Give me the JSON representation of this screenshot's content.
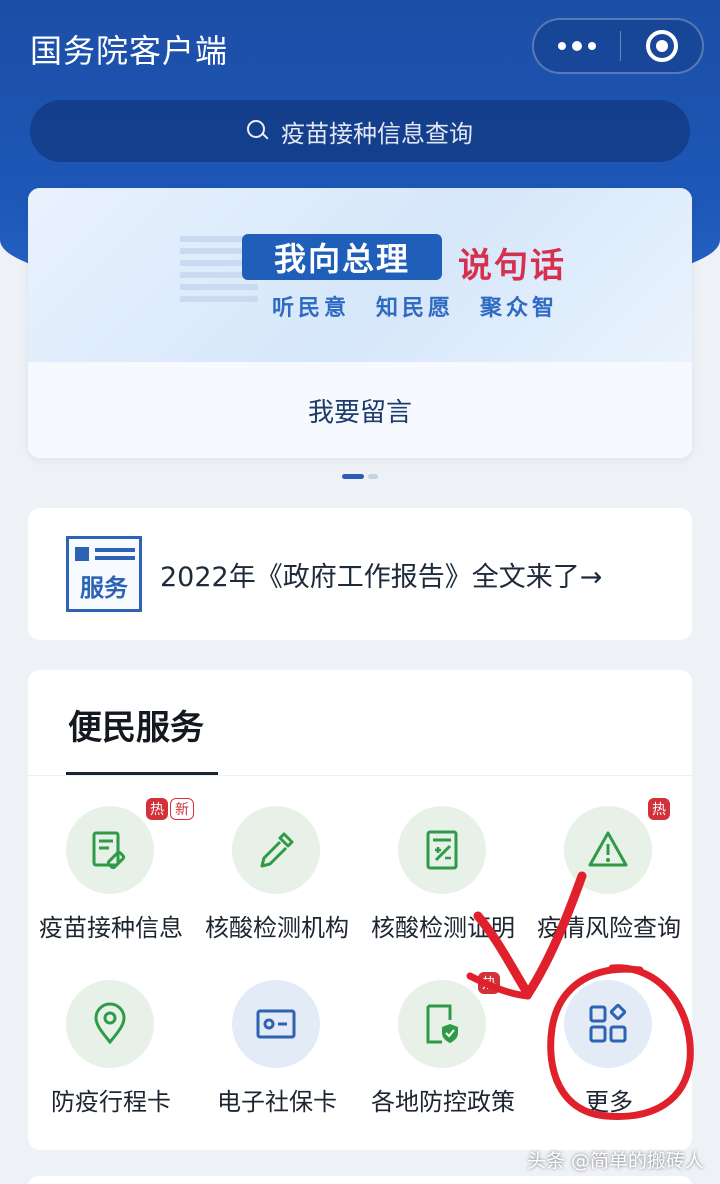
{
  "header": {
    "title": "国务院客户端",
    "search_placeholder": "疫苗接种信息查询"
  },
  "banner": {
    "highlight": "我向总理",
    "red": "说句话",
    "subtitle": "听民意　知民愿　聚众智",
    "button": "我要留言"
  },
  "report": {
    "icon_word": "服务",
    "text": "2022年《政府工作报告》全文来了→"
  },
  "services": {
    "title": "便民服务",
    "badge_hot": "热",
    "badge_new": "新",
    "items": [
      {
        "label": "疫苗接种信息",
        "icon": "vaccine-form-icon"
      },
      {
        "label": "核酸检测机构",
        "icon": "dropper-icon"
      },
      {
        "label": "核酸检测证明",
        "icon": "certificate-icon"
      },
      {
        "label": "疫情风险查询",
        "icon": "warning-icon"
      },
      {
        "label": "防疫行程卡",
        "icon": "location-pin-icon"
      },
      {
        "label": "电子社保卡",
        "icon": "id-card-icon"
      },
      {
        "label": "各地防控政策",
        "icon": "shield-doc-icon"
      },
      {
        "label": "更多",
        "icon": "grid-more-icon"
      }
    ]
  },
  "watermark": "头条 @简单的搬砖人",
  "colors": {
    "brand_blue": "#1e58b8",
    "icon_green": "#2f9a47",
    "icon_blue": "#2c63b4",
    "hot_red": "#d2313a",
    "annotation_red": "#e0202a"
  }
}
